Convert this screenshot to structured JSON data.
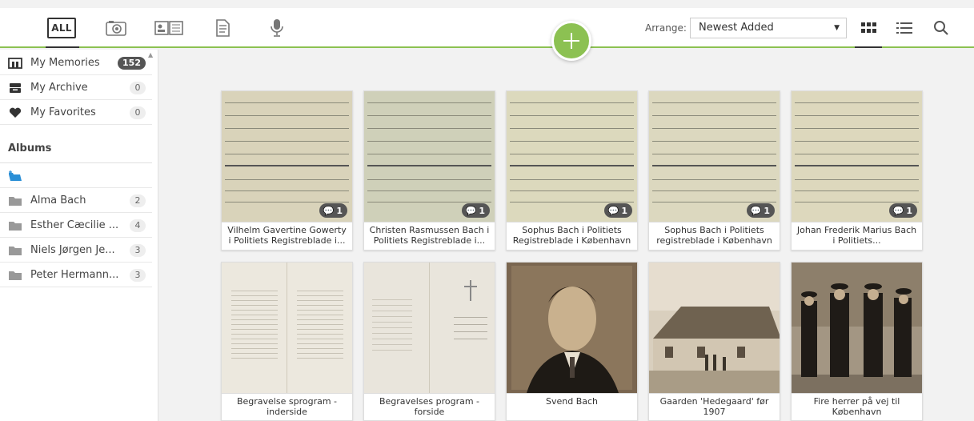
{
  "toolbar": {
    "filters": [
      {
        "label": "ALL",
        "icon": "all-icon"
      },
      {
        "icon": "camera-icon"
      },
      {
        "icon": "book-icon"
      },
      {
        "icon": "document-icon"
      },
      {
        "icon": "microphone-icon"
      }
    ],
    "arrange_label": "Arrange:",
    "arrange_value": "Newest Added",
    "accent_color": "#8cc152"
  },
  "sidebar": {
    "items": [
      {
        "label": "My Memories",
        "count": "152",
        "icon": "memories-icon"
      },
      {
        "label": "My Archive",
        "count": "0",
        "icon": "archive-icon"
      },
      {
        "label": "My Favorites",
        "count": "0",
        "icon": "heart-icon"
      }
    ],
    "albums_heading": "Albums",
    "albums": [
      {
        "label": "Alma Bach",
        "count": "2"
      },
      {
        "label": "Esther Cæcilie ...",
        "count": "4"
      },
      {
        "label": "Niels Jørgen Je...",
        "count": "3"
      },
      {
        "label": "Peter Hermann...",
        "count": "3"
      }
    ]
  },
  "cards": [
    {
      "caption": "Vilhelm Gavertine Gowerty i Politiets Registreblade i...",
      "comments": "1"
    },
    {
      "caption": "Christen Rasmussen Bach i Politiets Registreblade i...",
      "comments": "1"
    },
    {
      "caption": "Sophus Bach i Politiets Registreblade i København",
      "comments": "1"
    },
    {
      "caption": "Sophus Bach i Politiets registreblade i København",
      "comments": "1"
    },
    {
      "caption": "Johan Frederik Marius Bach i Politiets...",
      "comments": "1"
    },
    {
      "caption": "Begravelse sprogram - inderside"
    },
    {
      "caption": "Begravelses program - forside"
    },
    {
      "caption": "Svend Bach"
    },
    {
      "caption": "Gaarden 'Hedegaard' før 1907"
    },
    {
      "caption": "Fire herrer på vej til København"
    }
  ]
}
